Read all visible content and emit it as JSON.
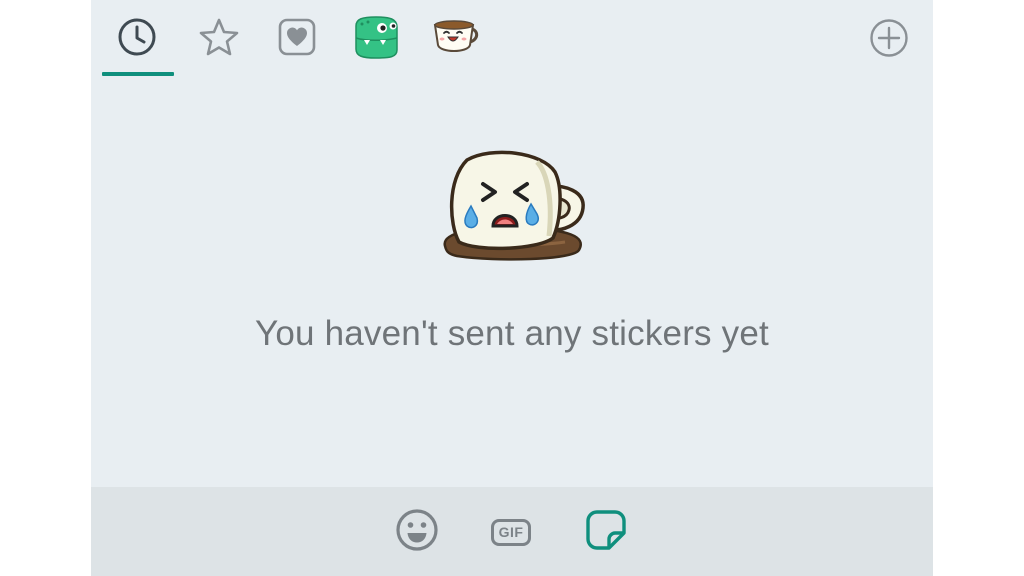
{
  "tabs": [
    {
      "id": "recent",
      "icon": "clock-icon",
      "active": true
    },
    {
      "id": "favorites",
      "icon": "star-icon",
      "active": false
    },
    {
      "id": "liked",
      "icon": "heart-icon",
      "active": false
    },
    {
      "id": "pack-dino",
      "icon": "dinosaur-sticker-icon",
      "active": false
    },
    {
      "id": "pack-cup",
      "icon": "coffee-cup-sticker-icon",
      "active": false
    }
  ],
  "add_icon": "plus-circle-icon",
  "empty_state": {
    "illustration": "crying-cup-sticker",
    "message": "You haven't sent any stickers yet"
  },
  "bottom_bar": {
    "emoji_icon": "smiley-icon",
    "gif_label": "GIF",
    "sticker_icon": "sticker-icon"
  },
  "colors": {
    "accent": "#0f8f7d",
    "panel_bg": "#e8eef2",
    "bottom_bg": "#dde3e6",
    "icon_gray": "#7c8388",
    "text_gray": "#6f7478"
  }
}
